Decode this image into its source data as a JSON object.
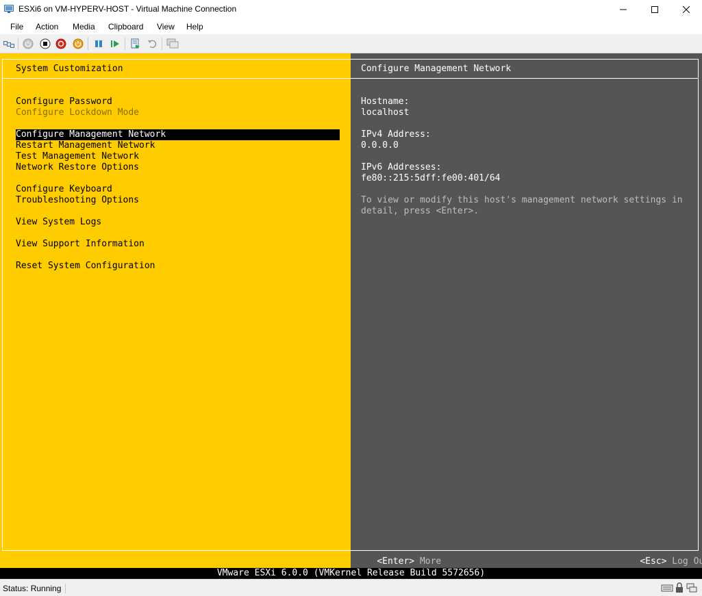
{
  "window": {
    "title": "ESXi6 on VM-HYPERV-HOST - Virtual Machine Connection",
    "icon": "vm-connection-icon"
  },
  "menu": {
    "items": [
      "File",
      "Action",
      "Media",
      "Clipboard",
      "View",
      "Help"
    ]
  },
  "toolbar": {
    "icons": [
      "ctrl-alt-del-icon",
      "start-icon",
      "turn-off-icon",
      "shutdown-icon",
      "save-state-icon",
      "pause-icon",
      "resume-icon",
      "checkpoint-icon",
      "revert-icon",
      "enhanced-session-icon"
    ]
  },
  "esxi": {
    "left_title": "System Customization",
    "menu_groups": [
      [
        {
          "label": "Configure Password",
          "state": "normal"
        },
        {
          "label": "Configure Lockdown Mode",
          "state": "disabled"
        }
      ],
      [
        {
          "label": "Configure Management Network",
          "state": "selected"
        },
        {
          "label": "Restart Management Network",
          "state": "normal"
        },
        {
          "label": "Test Management Network",
          "state": "normal"
        },
        {
          "label": "Network Restore Options",
          "state": "normal"
        }
      ],
      [
        {
          "label": "Configure Keyboard",
          "state": "normal"
        },
        {
          "label": "Troubleshooting Options",
          "state": "normal"
        }
      ],
      [
        {
          "label": "View System Logs",
          "state": "normal"
        }
      ],
      [
        {
          "label": "View Support Information",
          "state": "normal"
        }
      ],
      [
        {
          "label": "Reset System Configuration",
          "state": "normal"
        }
      ]
    ],
    "right_title": "Configure Management Network",
    "hostname_label": "Hostname:",
    "hostname_value": "localhost",
    "ipv4_label": "IPv4 Address:",
    "ipv4_value": "0.0.0.0",
    "ipv6_label": "IPv6 Addresses:",
    "ipv6_value": "fe80::215:5dff:fe00:401/64",
    "hint_line1": "To view or modify this host's management network settings in",
    "hint_line2": "detail, press <Enter>.",
    "enter_key": "<Enter>",
    "enter_action": "More",
    "esc_key": "<Esc>",
    "esc_action": "Log Out",
    "footer": "VMware ESXi 6.0.0 (VMKernel Release Build 5572656)"
  },
  "status": {
    "text": "Status: Running",
    "icons": [
      "keyboard-icon",
      "lock-icon",
      "network-icon"
    ]
  },
  "colors": {
    "esxi_yellow": "#ffcc00",
    "esxi_gray": "#555555",
    "disabled_text": "#8a6f00"
  }
}
